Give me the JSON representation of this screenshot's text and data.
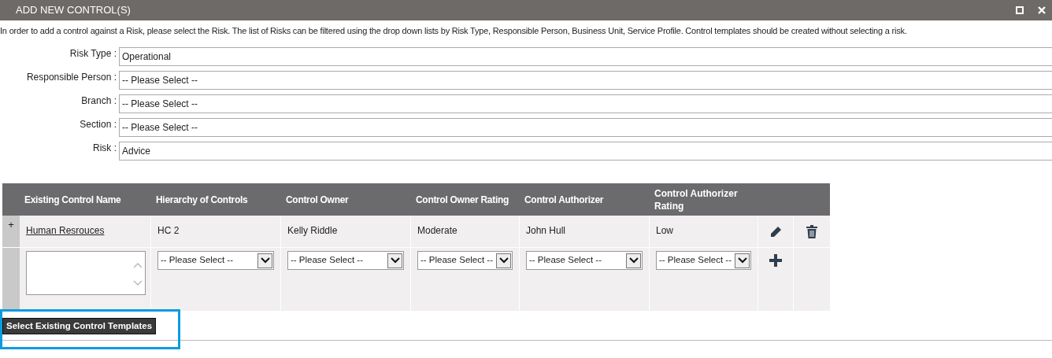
{
  "window": {
    "title": "ADD NEW CONTROL(S)"
  },
  "intro": "In order to add a control against a Risk, please select the Risk. The list of Risks can be filtered using the drop down lists by Risk Type, Responsible Person, Business Unit, Service Profile. Control templates should be created without selecting a risk.",
  "filters": [
    {
      "label": "Risk Type :",
      "value": "Operational"
    },
    {
      "label": "Responsible Person :",
      "value": "-- Please Select --"
    },
    {
      "label": "Branch :",
      "value": "-- Please Select --"
    },
    {
      "label": "Section :",
      "value": "-- Please Select --"
    },
    {
      "label": "Risk :",
      "value": "Advice"
    }
  ],
  "table": {
    "columns": [
      "Existing Control Name",
      "Hierarchy of Controls",
      "Control Owner",
      "Control Owner Rating",
      "Control Authorizer",
      "Control Authorizer Rating"
    ],
    "rows": [
      {
        "expander": "+",
        "cells": [
          "Human Resrouces",
          "HC 2",
          "Kelly Riddle",
          "Moderate",
          "John Hull",
          "Low"
        ]
      }
    ],
    "new_row": {
      "selects": [
        "-- Please Select --",
        "-- Please Select --",
        "-- Please Select --",
        "-- Please Select --",
        "-- Please Select --"
      ]
    }
  },
  "buttons": [
    "Select Existing Control Templates"
  ]
}
